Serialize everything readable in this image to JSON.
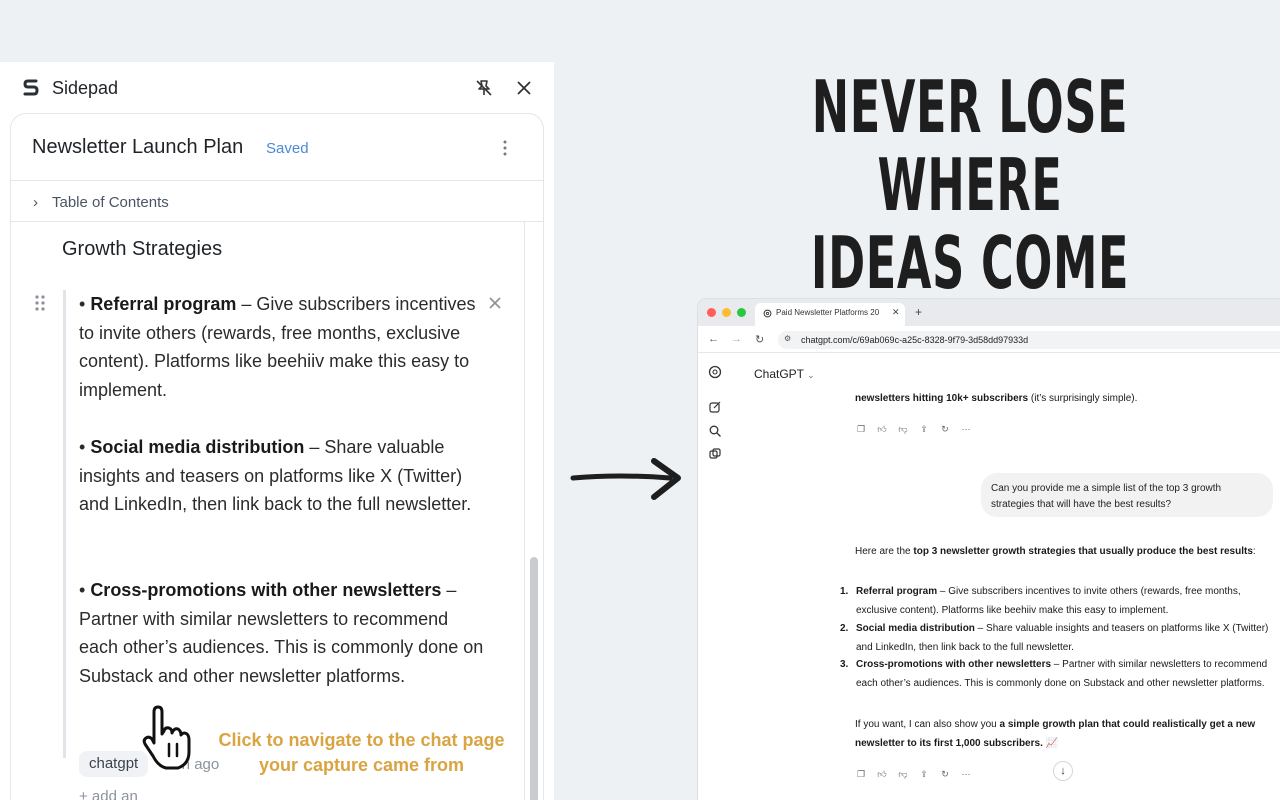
{
  "sidepad": {
    "app_name": "Sidepad",
    "doc_title": "Newsletter Launch Plan",
    "doc_status": "Saved",
    "toc_label": "Table of Contents",
    "section_heading": "Growth Strategies",
    "items": [
      {
        "bullet": "• ",
        "title": "Referral program",
        "body": " – Give subscribers incentives to invite others (rewards, free months, exclusive content). Platforms like beehiiv make this easy to implement."
      },
      {
        "bullet": "• ",
        "title": "Social media distribution",
        "body": " – Share valuable insights and teasers on platforms like X (Twitter) and LinkedIn, then link back to the full newsletter."
      },
      {
        "bullet": "• ",
        "title": "Cross-promotions with other newsletters",
        "body": " – Partner with similar newsletters to recommend each other’s audiences. This is commonly done on Substack and other newsletter platforms."
      }
    ],
    "source_chip": "chatgpt",
    "source_time": "15h ago",
    "add_note": "+ add an"
  },
  "callout": {
    "line1": "Click to navigate to the chat page",
    "line2": "your capture came from",
    "color": "#d9a441"
  },
  "headline": {
    "line1": "NEVER LOSE WHERE",
    "line2": "IDEAS COME FROM"
  },
  "browser": {
    "tab_title": "Paid Newsletter Platforms 20",
    "url": "chatgpt.com/c/69ab069c-a25c-8328-9f79-3d58dd97933d",
    "chat_model": "ChatGPT",
    "prev_line_bold": "newsletters hitting 10k+ subscribers",
    "prev_line_rest": " (it’s surprisingly simple).",
    "user_message": "Can you provide me a simple list of the top 3 growth strategies that will have the best results?",
    "answer_intro_pre": "Here are the ",
    "answer_intro_bold": "top 3 newsletter growth strategies that usually produce the best results",
    "answer_intro_post": ":",
    "list": [
      {
        "num": "1.",
        "title": "Referral program",
        "body": " – Give subscribers incentives to invite others (rewards, free months, exclusive content). Platforms like beehiiv make this easy to implement."
      },
      {
        "num": "2.",
        "title": "Social media distribution",
        "body": " – Share valuable insights and teasers on platforms like X (Twitter) and LinkedIn, then link back to the full newsletter."
      },
      {
        "num": "3.",
        "title": "Cross-promotions with other newsletters",
        "body": " – Partner with similar newsletters to recommend each other’s audiences. This is commonly done on Substack and other newsletter platforms."
      }
    ],
    "closing_pre": "If you want, I can also show you ",
    "closing_bold": "a simple growth plan that could realistically get a new newsletter to its first 1,000 subscribers.",
    "closing_emoji": " 📈"
  }
}
